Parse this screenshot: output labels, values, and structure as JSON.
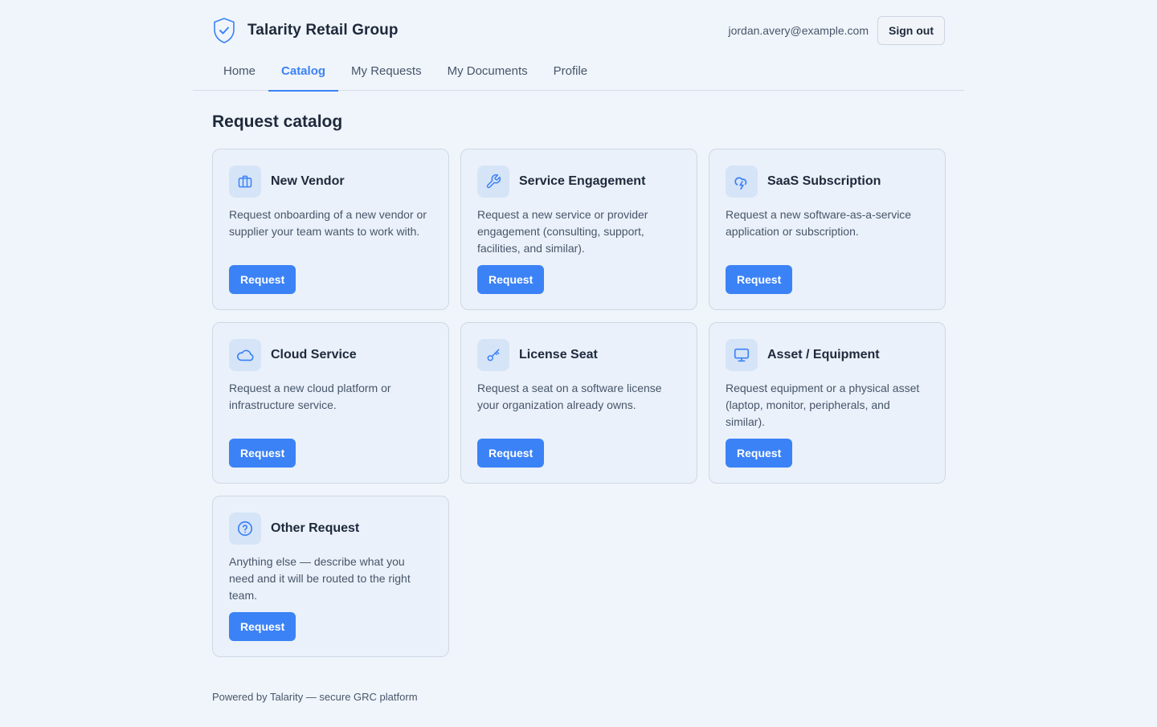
{
  "brand": {
    "name": "Talarity Retail Group",
    "logo_icon": "shield-check-icon"
  },
  "user": {
    "email": "jordan.avery@example.com",
    "signout_label": "Sign out"
  },
  "nav": {
    "tabs": [
      {
        "label": "Home",
        "active": false
      },
      {
        "label": "Catalog",
        "active": true
      },
      {
        "label": "My Requests",
        "active": false
      },
      {
        "label": "My Documents",
        "active": false
      },
      {
        "label": "Profile",
        "active": false
      }
    ]
  },
  "page": {
    "title": "Request catalog"
  },
  "catalog": {
    "button_label": "Request",
    "items": [
      {
        "title": "New Vendor",
        "icon": "briefcase-icon",
        "description": "Request onboarding of a new vendor or supplier your team wants to work with."
      },
      {
        "title": "Service Engagement",
        "icon": "wrench-icon",
        "description": "Request a new service or provider engagement (consulting, support, facilities, and similar)."
      },
      {
        "title": "SaaS Subscription",
        "icon": "cloud-lightning-icon",
        "description": "Request a new software-as-a-service application or subscription."
      },
      {
        "title": "Cloud Service",
        "icon": "cloud-icon",
        "description": "Request a new cloud platform or infrastructure service."
      },
      {
        "title": "License Seat",
        "icon": "key-icon",
        "description": "Request a seat on a software license your organization already owns."
      },
      {
        "title": "Asset / Equipment",
        "icon": "monitor-icon",
        "description": "Request equipment or a physical asset (laptop, monitor, peripherals, and similar)."
      },
      {
        "title": "Other Request",
        "icon": "help-circle-icon",
        "description": "Anything else — describe what you need and it will be routed to the right team."
      }
    ]
  },
  "footer": {
    "text": "Powered by Talarity — secure GRC platform"
  },
  "colors": {
    "accent": "#3b82f6",
    "background": "#f0f5fb",
    "card": "#eaf1fa"
  }
}
